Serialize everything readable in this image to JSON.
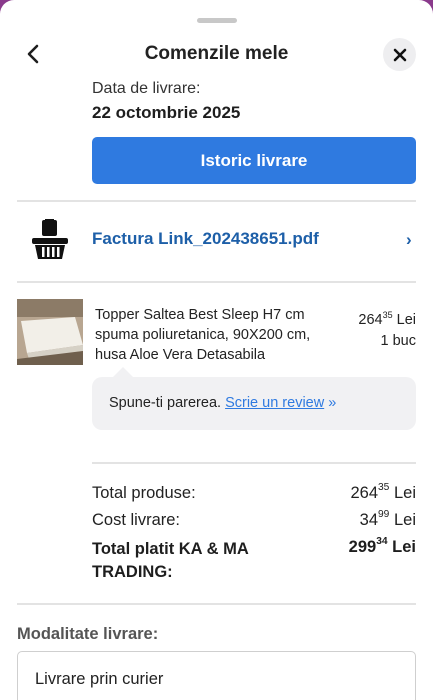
{
  "header": {
    "title": "Comenzile mele"
  },
  "delivery": {
    "label": "Data de livrare:",
    "date": "22 octombrie 2025",
    "history_button": "Istoric livrare"
  },
  "invoice": {
    "link_text": "Factura Link_202438651.pdf",
    "chevron": "›"
  },
  "product": {
    "name": "Topper Saltea Best Sleep H7 cm spuma poliuretanica, 90X200 cm, husa Aloe Vera Detasabila",
    "price_int": "264",
    "price_dec": "35",
    "currency": "Lei",
    "quantity": "1 buc"
  },
  "review": {
    "prompt": "Spune-ti parerea.",
    "link": "Scrie un review",
    "raquo": "»"
  },
  "summary": {
    "products_label": "Total produse:",
    "products_int": "264",
    "products_dec": "35",
    "shipping_label": "Cost livrare:",
    "shipping_int": "34",
    "shipping_dec": "99",
    "total_label": "Total platit KA & MA TRADING:",
    "total_int": "299",
    "total_dec": "34",
    "currency": "Lei"
  },
  "shipping_method": {
    "label": "Modalitate livrare:",
    "value": "Livrare prin curier"
  },
  "colors": {
    "accent": "#2f7ae0",
    "link": "#1d5fa8",
    "background_behind_sheet": "#8a3a8c"
  },
  "icons": [
    "chevron-left-icon",
    "close-icon",
    "shopping-basket-icon",
    "chevron-right-icon"
  ]
}
